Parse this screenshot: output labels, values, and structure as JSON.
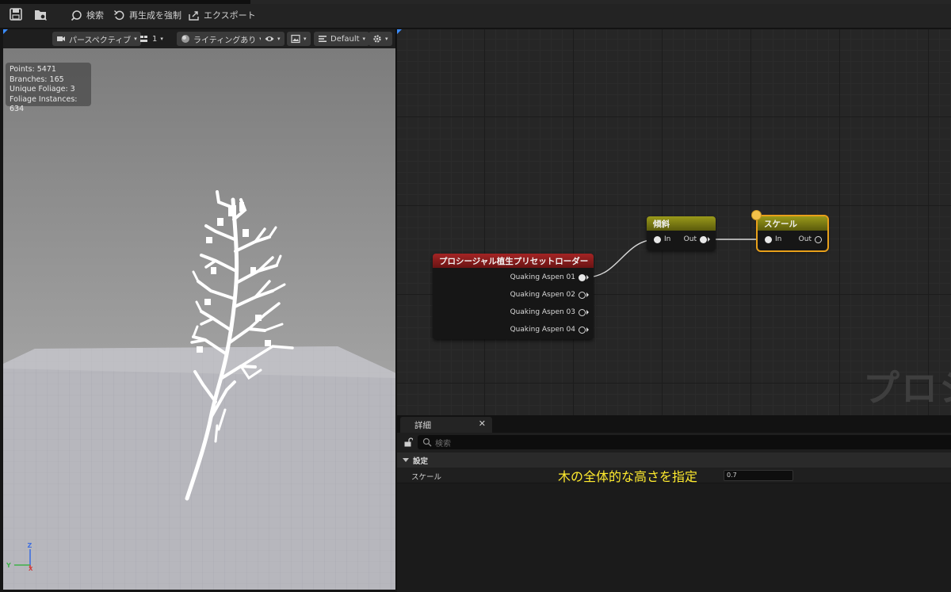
{
  "toolbar": {
    "search_label": "検索",
    "regenerate_label": "再生成を強制",
    "export_label": "エクスポート"
  },
  "viewport": {
    "perspective_label": "パースペクティブ",
    "camera_speed_label": "1",
    "lighting_label": "ライティングあり",
    "layout_label": "Default",
    "stats": {
      "points": "Points: 5471",
      "branches": "Branches: 165",
      "unique_foliage": "Unique Foliage: 3",
      "foliage_instances": "Foliage Instances: 634"
    },
    "axis": {
      "z": "Z",
      "y": "Y",
      "x": "X"
    }
  },
  "graph": {
    "watermark": "プロシ",
    "nodes": {
      "loader": {
        "title": "プロシージャル植生プリセットローダー",
        "header_color": "#8e1c1c",
        "outputs": [
          "Quaking Aspen 01",
          "Quaking Aspen 02",
          "Quaking Aspen 03",
          "Quaking Aspen 04"
        ]
      },
      "tilt": {
        "title": "傾斜",
        "header_color": "#7d7d12",
        "in": "In",
        "out": "Out"
      },
      "scale": {
        "title": "スケール",
        "header_color": "#7d7d12",
        "in": "In",
        "out": "Out"
      }
    },
    "selection_color": "#e8a01a"
  },
  "details": {
    "tab_label": "詳細",
    "search_placeholder": "検索",
    "section_label": "設定",
    "property_label": "スケール",
    "property_annotation": "木の全体的な高さを指定",
    "property_value": "0.7"
  }
}
